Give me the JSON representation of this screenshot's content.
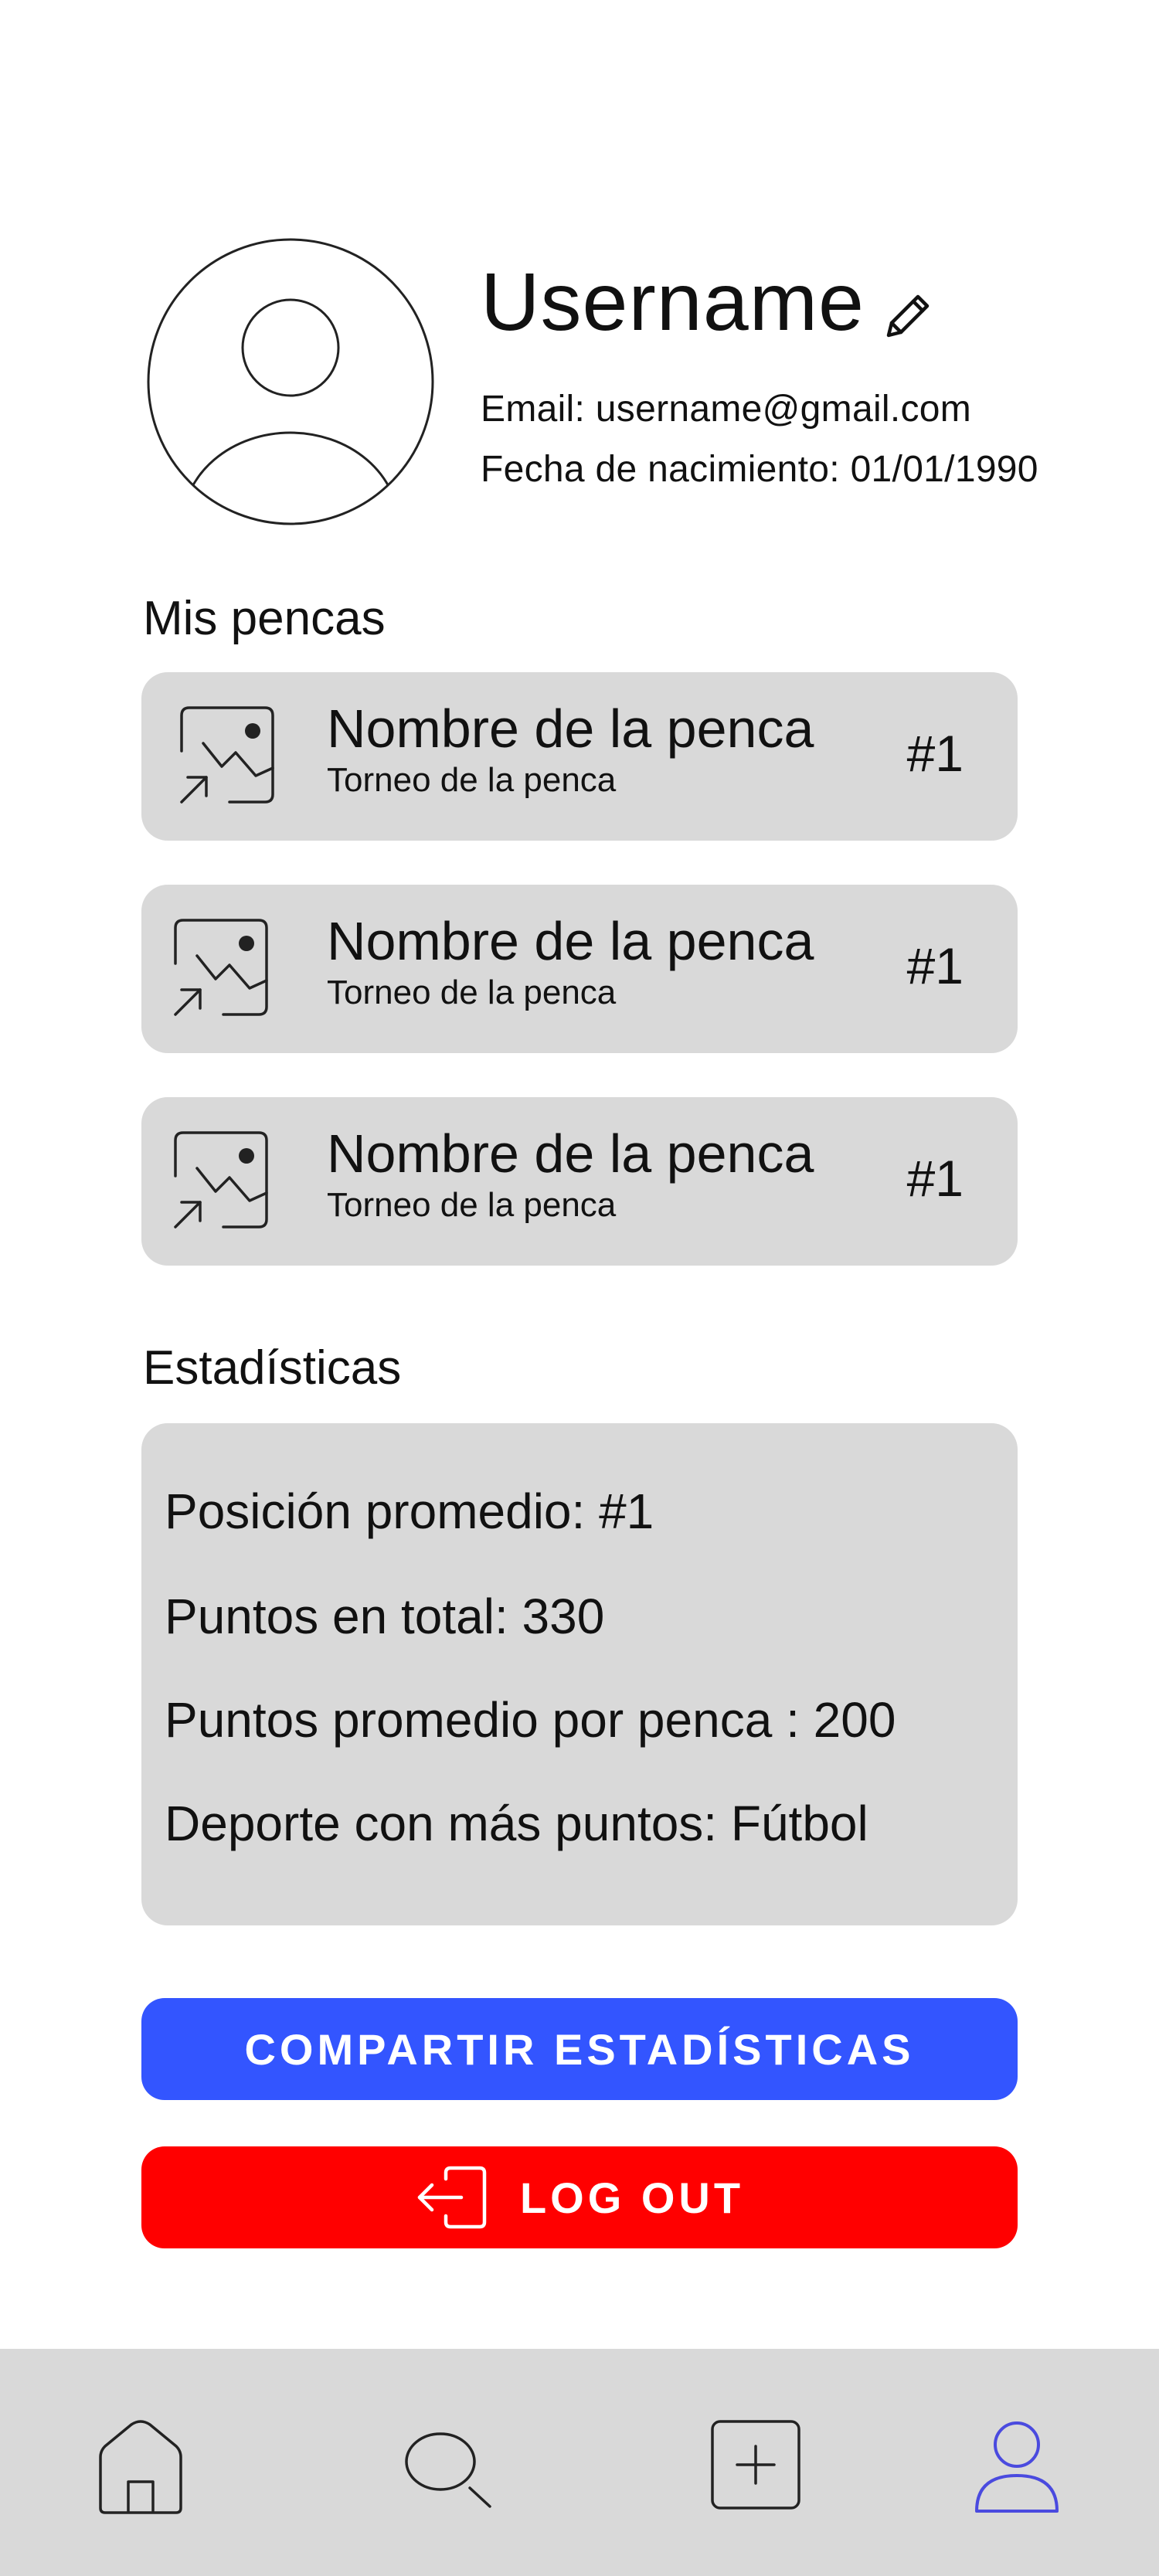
{
  "profile": {
    "username": "Username",
    "email": "Email: username@gmail.com",
    "birthdate": "Fecha de nacimiento: 01/01/1990",
    "avatar_icon": "user-avatar-icon",
    "edit_icon": "pencil-icon"
  },
  "pencas": {
    "title": "Mis pencas",
    "items": [
      {
        "name": "Nombre de la penca",
        "tournament": "Torneo de la penca",
        "rank": "#1",
        "icon": "image-placeholder-icon"
      },
      {
        "name": "Nombre de la penca",
        "tournament": "Torneo de la penca",
        "rank": "#1",
        "icon": "image-placeholder-icon"
      },
      {
        "name": "Nombre de la penca",
        "tournament": "Torneo de la penca",
        "rank": "#1",
        "icon": "image-placeholder-icon"
      }
    ]
  },
  "stats": {
    "title": "Estadísticas",
    "lines": [
      "Posición promedio: #1",
      "Puntos en total: 330",
      "Puntos promedio por penca : 200",
      "Deporte con más puntos: Fútbol"
    ]
  },
  "actions": {
    "share_label": "COMPARTIR ESTADÍSTICAS",
    "logout_label": "LOG OUT",
    "logout_icon": "logout-icon"
  },
  "nav": {
    "items": [
      {
        "id": "home",
        "icon": "home-icon"
      },
      {
        "id": "search",
        "icon": "search-icon"
      },
      {
        "id": "add",
        "icon": "plus-square-icon"
      },
      {
        "id": "profile",
        "icon": "user-icon",
        "active": true
      }
    ]
  },
  "colors": {
    "card_bg": "#d9d9d9",
    "share_button": "#3355ff",
    "logout_button": "#ff0000",
    "nav_bg": "#d9d9d9",
    "active_nav": "#4a4adf"
  }
}
